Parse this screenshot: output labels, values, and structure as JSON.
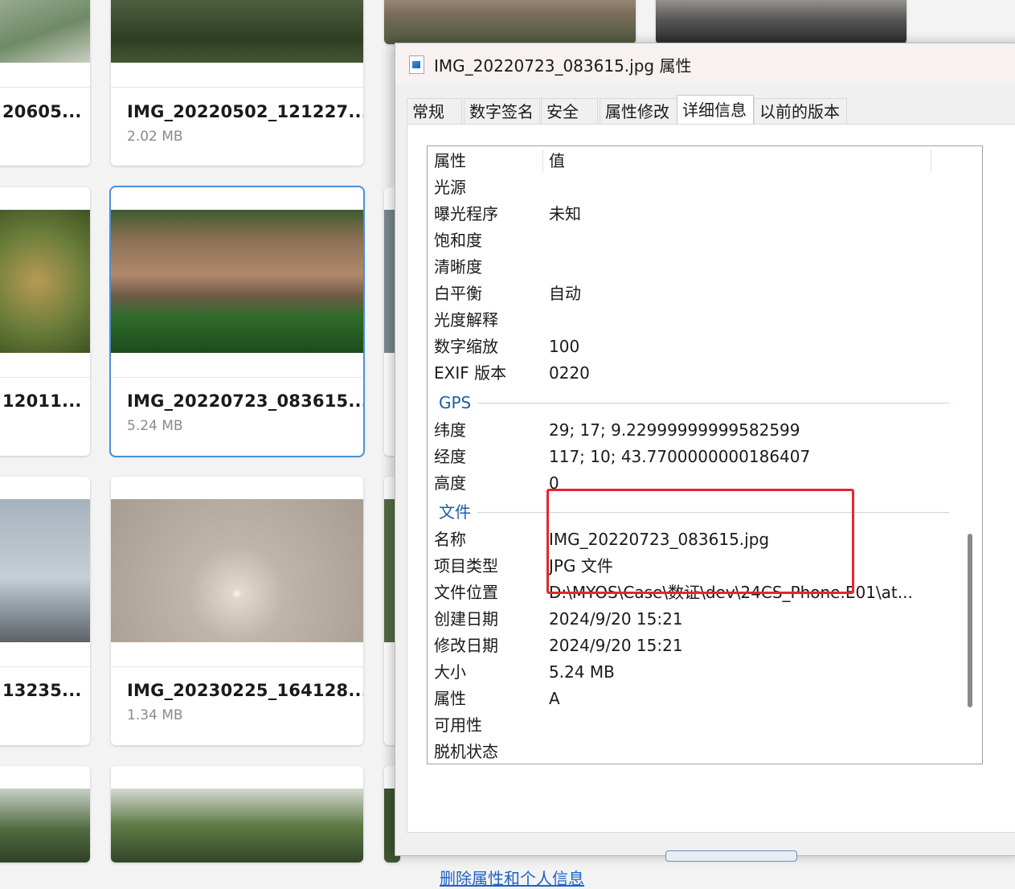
{
  "gallery": [
    {
      "name": "20605...",
      "size": ""
    },
    {
      "name": "IMG_20220502_121227...",
      "size": "2.02 MB"
    },
    {
      "name": "12011...",
      "size": ""
    },
    {
      "name": "IMG_20220723_083615...",
      "size": "5.24 MB"
    },
    {
      "name": "13235...",
      "size": ""
    },
    {
      "name": "IMG_20230225_164128...",
      "size": "1.34 MB"
    }
  ],
  "dialog": {
    "title": "IMG_20220723_083615.jpg 属性",
    "tabs": [
      "常规",
      "数字签名",
      "安全",
      "属性修改",
      "详细信息",
      "以前的版本"
    ],
    "active_tab": "详细信息",
    "header": {
      "property": "属性",
      "value": "值"
    },
    "rows_camera": [
      {
        "k": "光源",
        "v": ""
      },
      {
        "k": "曝光程序",
        "v": "未知"
      },
      {
        "k": "饱和度",
        "v": ""
      },
      {
        "k": "清晰度",
        "v": ""
      },
      {
        "k": "白平衡",
        "v": "自动"
      },
      {
        "k": "光度解释",
        "v": ""
      },
      {
        "k": "数字缩放",
        "v": "100"
      },
      {
        "k": "EXIF 版本",
        "v": "0220"
      }
    ],
    "section_gps": "GPS",
    "rows_gps": [
      {
        "k": "纬度",
        "v": "29; 17; 9.22999999999582599"
      },
      {
        "k": "经度",
        "v": "117; 10; 43.7700000000186407"
      },
      {
        "k": "高度",
        "v": "0"
      }
    ],
    "section_file": "文件",
    "rows_file": [
      {
        "k": "名称",
        "v": "IMG_20220723_083615.jpg"
      },
      {
        "k": "项目类型",
        "v": "JPG 文件"
      },
      {
        "k": "文件位置",
        "v": "D:\\MYOS\\Case\\数证\\dev\\24CS_Phone.E01\\at..."
      },
      {
        "k": "创建日期",
        "v": "2024/9/20 15:21"
      },
      {
        "k": "修改日期",
        "v": "2024/9/20 15:21"
      },
      {
        "k": "大小",
        "v": "5.24 MB"
      },
      {
        "k": "属性",
        "v": "A"
      },
      {
        "k": "可用性",
        "v": ""
      },
      {
        "k": "脱机状态",
        "v": ""
      }
    ],
    "remove_link": "删除属性和个人信息"
  },
  "colors": {
    "accent": "#1f5ca8",
    "link": "#1f63c3",
    "highlight_box": "#e5262e",
    "selected_card": "#4a8fd9"
  }
}
